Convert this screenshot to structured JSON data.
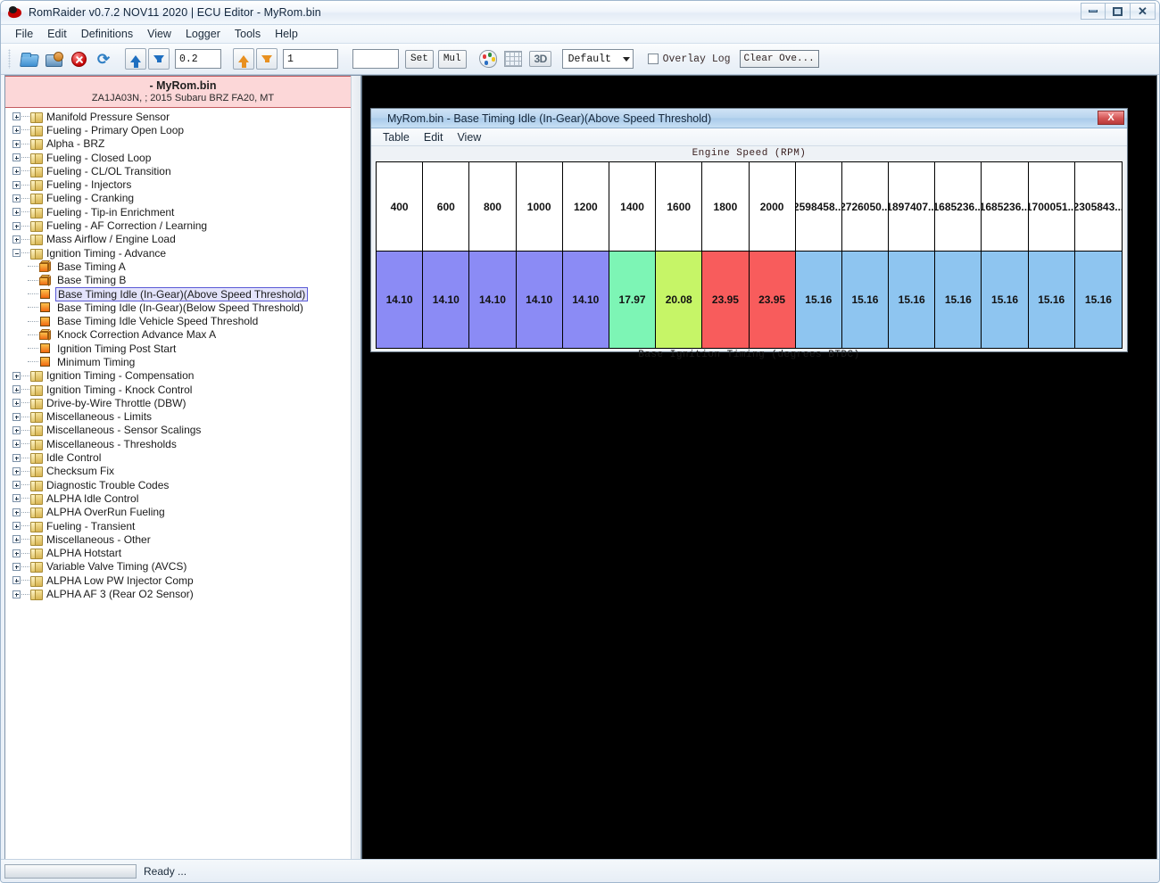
{
  "window": {
    "title": "RomRaider v0.7.2 NOV11 2020 | ECU Editor - MyRom.bin",
    "app_icon": "romraider-icon",
    "buttons": {
      "minimize": "minimize-icon",
      "maximize": "maximize-icon",
      "close": "close-icon"
    }
  },
  "menubar": {
    "items": [
      "File",
      "Edit",
      "Definitions",
      "View",
      "Logger",
      "Tools",
      "Help"
    ]
  },
  "toolbar": {
    "open_icon": "open-folder-icon",
    "save_icon": "save-image-icon",
    "close_icon": "close-rom-icon",
    "refresh_icon": "refresh-icon",
    "increment_coarse_icon": "arrow-up-blue-icon",
    "decrement_coarse_icon": "arrow-down-blue-icon",
    "coarse_value": "0.2",
    "increment_fine_icon": "arrow-up-orange-icon",
    "decrement_fine_icon": "arrow-down-orange-icon",
    "fine_value": "1",
    "set_value": "",
    "set_label": "Set",
    "mul_label": "Mul",
    "palette_icon": "color-palette-icon",
    "grid_icon": "table-grid-icon",
    "threed_label": "3D",
    "layout_selected": "Default",
    "overlay_log_label": "Overlay Log",
    "overlay_log_checked": false,
    "clear_overlay_label": "Clear Ove..."
  },
  "sidebar": {
    "rom_title": "- MyRom.bin",
    "rom_subtitle": "ZA1JA03N, ; 2015 Subaru BRZ FA20, MT",
    "items": [
      {
        "label": "Manifold Pressure Sensor",
        "type": "folder",
        "depth": 0,
        "expander": "plus"
      },
      {
        "label": "Fueling - Primary Open Loop",
        "type": "folder",
        "depth": 0,
        "expander": "plus"
      },
      {
        "label": "Alpha - BRZ",
        "type": "folder",
        "depth": 0,
        "expander": "plus"
      },
      {
        "label": "Fueling - Closed Loop",
        "type": "folder",
        "depth": 0,
        "expander": "plus"
      },
      {
        "label": "Fueling - CL/OL Transition",
        "type": "folder",
        "depth": 0,
        "expander": "plus"
      },
      {
        "label": "Fueling - Injectors",
        "type": "folder",
        "depth": 0,
        "expander": "plus"
      },
      {
        "label": "Fueling - Cranking",
        "type": "folder",
        "depth": 0,
        "expander": "plus"
      },
      {
        "label": "Fueling - Tip-in Enrichment",
        "type": "folder",
        "depth": 0,
        "expander": "plus"
      },
      {
        "label": "Fueling - AF Correction / Learning",
        "type": "folder",
        "depth": 0,
        "expander": "plus"
      },
      {
        "label": "Mass Airflow / Engine Load",
        "type": "folder",
        "depth": 0,
        "expander": "plus"
      },
      {
        "label": "Ignition Timing - Advance",
        "type": "folder",
        "depth": 0,
        "expander": "minus"
      },
      {
        "label": "Base Timing A",
        "type": "cube",
        "depth": 1,
        "expander": "none"
      },
      {
        "label": "Base Timing B",
        "type": "cube",
        "depth": 1,
        "expander": "none"
      },
      {
        "label": "Base Timing Idle (In-Gear)(Above Speed Threshold)",
        "type": "square",
        "depth": 1,
        "expander": "none",
        "selected": true
      },
      {
        "label": "Base Timing Idle (In-Gear)(Below Speed Threshold)",
        "type": "square",
        "depth": 1,
        "expander": "none"
      },
      {
        "label": "Base Timing Idle Vehicle Speed Threshold",
        "type": "square",
        "depth": 1,
        "expander": "none"
      },
      {
        "label": "Knock Correction Advance Max A",
        "type": "cube",
        "depth": 1,
        "expander": "none"
      },
      {
        "label": "Ignition Timing Post Start",
        "type": "square",
        "depth": 1,
        "expander": "none"
      },
      {
        "label": "Minimum Timing",
        "type": "square",
        "depth": 1,
        "expander": "none"
      },
      {
        "label": "Ignition Timing - Compensation",
        "type": "folder",
        "depth": 0,
        "expander": "plus"
      },
      {
        "label": "Ignition Timing - Knock Control",
        "type": "folder",
        "depth": 0,
        "expander": "plus"
      },
      {
        "label": "Drive-by-Wire Throttle (DBW)",
        "type": "folder",
        "depth": 0,
        "expander": "plus"
      },
      {
        "label": "Miscellaneous - Limits",
        "type": "folder",
        "depth": 0,
        "expander": "plus"
      },
      {
        "label": "Miscellaneous - Sensor Scalings",
        "type": "folder",
        "depth": 0,
        "expander": "plus"
      },
      {
        "label": "Miscellaneous - Thresholds",
        "type": "folder",
        "depth": 0,
        "expander": "plus"
      },
      {
        "label": "Idle Control",
        "type": "folder",
        "depth": 0,
        "expander": "plus"
      },
      {
        "label": "Checksum Fix",
        "type": "folder",
        "depth": 0,
        "expander": "plus"
      },
      {
        "label": "Diagnostic Trouble Codes",
        "type": "folder",
        "depth": 0,
        "expander": "plus"
      },
      {
        "label": "ALPHA Idle Control",
        "type": "folder",
        "depth": 0,
        "expander": "plus"
      },
      {
        "label": "ALPHA OverRun Fueling",
        "type": "folder",
        "depth": 0,
        "expander": "plus"
      },
      {
        "label": "Fueling - Transient",
        "type": "folder",
        "depth": 0,
        "expander": "plus"
      },
      {
        "label": "Miscellaneous - Other",
        "type": "folder",
        "depth": 0,
        "expander": "plus"
      },
      {
        "label": "ALPHA Hotstart",
        "type": "folder",
        "depth": 0,
        "expander": "plus"
      },
      {
        "label": "Variable Valve Timing (AVCS)",
        "type": "folder",
        "depth": 0,
        "expander": "plus"
      },
      {
        "label": "ALPHA Low PW Injector Comp",
        "type": "folder",
        "depth": 0,
        "expander": "plus"
      },
      {
        "label": "ALPHA AF 3 (Rear O2 Sensor)",
        "type": "folder",
        "depth": 0,
        "expander": "plus"
      }
    ]
  },
  "table_window": {
    "title": "MyRom.bin - Base Timing Idle (In-Gear)(Above Speed Threshold)",
    "close_label": "X",
    "menu": [
      "Table",
      "Edit",
      "View"
    ],
    "axis_top_label": "Engine Speed (RPM)",
    "axis_bottom_label": "Base Ignition Timing (degrees BTDC)"
  },
  "chart_data": {
    "type": "table",
    "title": "Base Timing Idle (In-Gear)(Above Speed Threshold)",
    "xlabel": "Engine Speed (RPM)",
    "ylabel": "Base Ignition Timing (degrees BTDC)",
    "categories": [
      "400",
      "600",
      "800",
      "1000",
      "1200",
      "1400",
      "1600",
      "1800",
      "2000",
      "2598458...",
      "2726050...",
      "1897407...",
      "1685236...",
      "1685236...",
      "1700051...",
      "2305843..."
    ],
    "values": [
      "14.10",
      "14.10",
      "14.10",
      "14.10",
      "14.10",
      "17.97",
      "20.08",
      "23.95",
      "23.95",
      "15.16",
      "15.16",
      "15.16",
      "15.16",
      "15.16",
      "15.16",
      "15.16"
    ],
    "cell_colors": [
      "#8b8bf5",
      "#8b8bf5",
      "#8b8bf5",
      "#8b8bf5",
      "#8b8bf5",
      "#7df5b5",
      "#c6f567",
      "#f85c5c",
      "#f85c5c",
      "#8ec5f0",
      "#8ec5f0",
      "#8ec5f0",
      "#8ec5f0",
      "#8ec5f0",
      "#8ec5f0",
      "#8ec5f0"
    ],
    "header_color": "#ffffff"
  },
  "statusbar": {
    "progress_value": "",
    "text": "Ready ..."
  },
  "colors": {
    "rom_header_bg": "#fcd7d8",
    "selection_border": "#5a5ad6",
    "workspace_bg": "#000000",
    "purple": "#8b8bf5",
    "mint": "#7df5b5",
    "lime": "#c6f567",
    "red": "#f85c5c",
    "blue": "#8ec5f0"
  }
}
